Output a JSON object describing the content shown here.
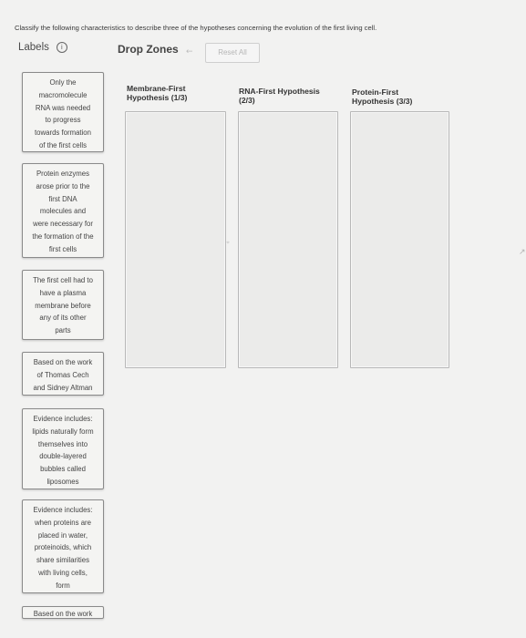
{
  "instructions": "Classify the following characteristics to describe three of the hypotheses concerning the evolution of the first living cell.",
  "labels_heading": "Labels",
  "info_glyph": "i",
  "dropzones_heading": "Drop Zones",
  "back_arrow": "←",
  "reset_label": "Reset All",
  "labels": [
    "Only the\nmacromolecule\nRNA was needed\nto progress\ntowards formation\nof the first cells",
    "Protein enzymes\narose prior to the\nfirst DNA\nmolecules and\nwere necessary for\nthe formation of the\nfirst cells",
    "The first cell had to\nhave a plasma\nmembrane before\nany of its other\nparts",
    "Based on the work\nof Thomas Cech\nand Sidney Altman",
    "Evidence includes:\nlipids naturally form\nthemselves into\ndouble-layered\nbubbles called\nliposomes",
    "Evidence includes:\nwhen proteins are\nplaced in water,\nproteinoids, which\nshare similarities\nwith living cells,\nform",
    "Based on the work"
  ],
  "zones": [
    {
      "title": "Membrane-First\nHypothesis (1/3)"
    },
    {
      "title": "RNA-First Hypothesis\n(2/3)"
    },
    {
      "title": "Protein-First\nHypothesis (3/3)"
    }
  ],
  "pointer_glyph": "↗",
  "cursor_glyph": "⌖"
}
